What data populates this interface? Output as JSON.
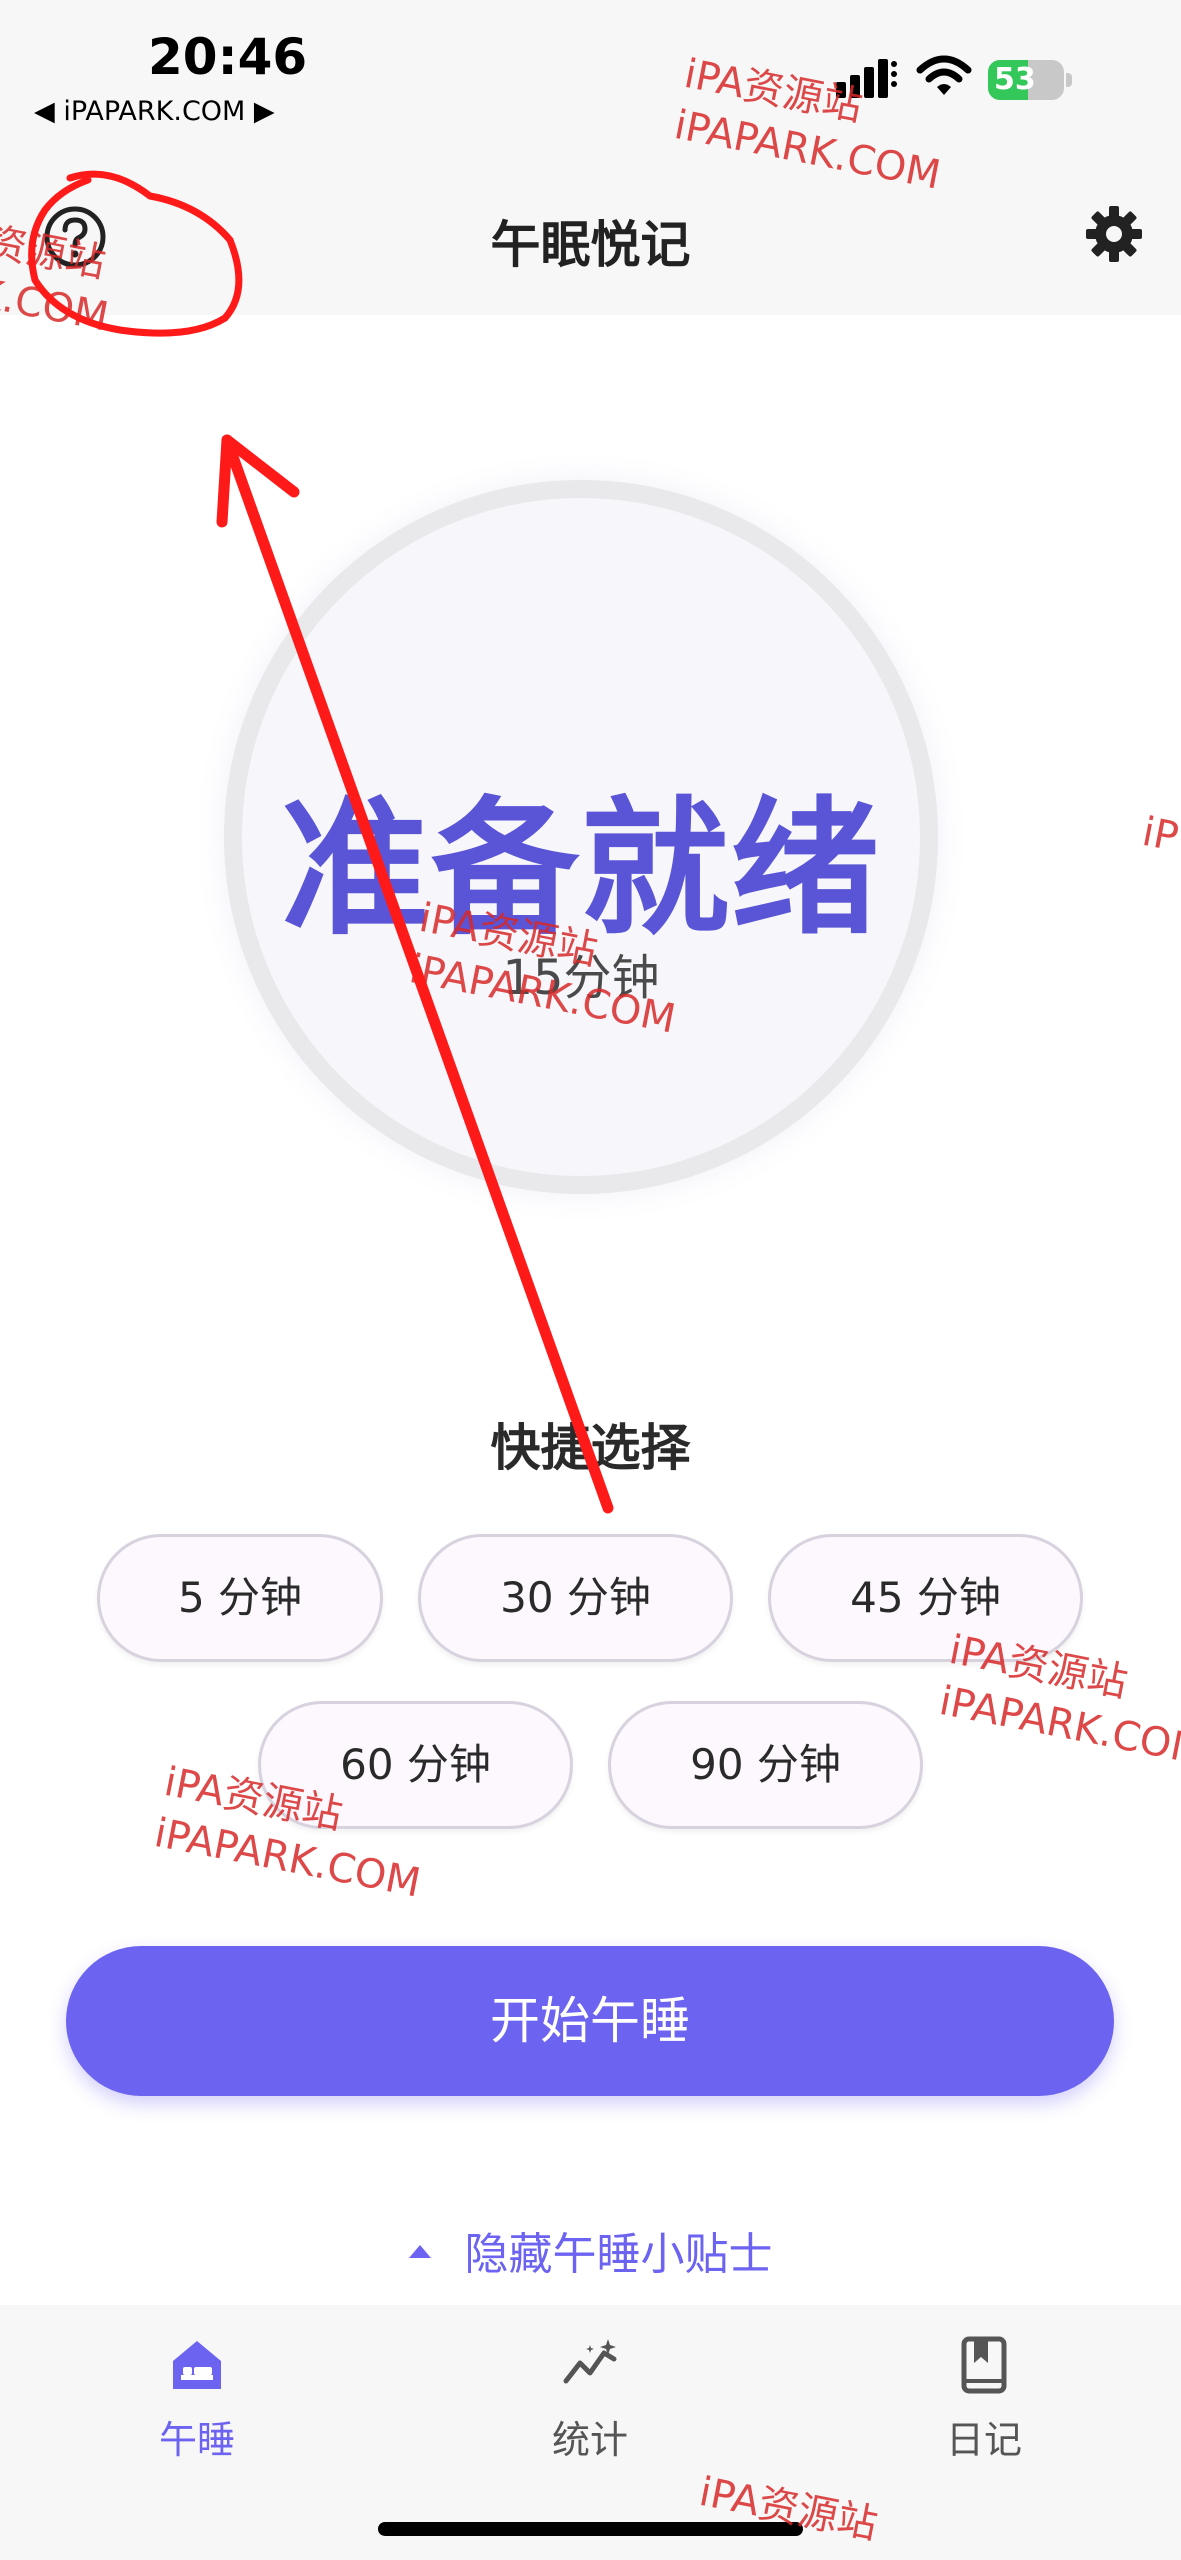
{
  "status_bar": {
    "time": "20:46",
    "back_link": "◀ iPAPARK.COM ▶",
    "battery_level": "53",
    "battery_fraction": 0.53
  },
  "header": {
    "title": "午眠悦记",
    "help_icon": "question-circle-icon",
    "settings_icon": "gear-icon"
  },
  "timer": {
    "status": "准备就绪",
    "duration": "15分钟"
  },
  "quick_select": {
    "title": "快捷选择",
    "options": [
      "5 分钟",
      "30 分钟",
      "45 分钟",
      "60 分钟",
      "90 分钟"
    ]
  },
  "start_button": {
    "label": "开始午睡"
  },
  "tips": {
    "toggle_label": "隐藏午睡小贴士"
  },
  "bottom_nav": {
    "items": [
      {
        "label": "午睡",
        "icon": "bed-icon",
        "active": true
      },
      {
        "label": "统计",
        "icon": "trend-chart-icon",
        "active": false
      },
      {
        "label": "日记",
        "icon": "bookmark-book-icon",
        "active": false
      }
    ]
  },
  "watermark": {
    "line1": "iPA资源站",
    "line2": "iPAPARK.COM",
    "fragment_site": "资源站",
    "fragment_com": "K.COM",
    "fragment_edge": "iP"
  },
  "colors": {
    "accent": "#6c63f0",
    "status_text": "#5a55d6",
    "annotation_red": "#ff1a1a",
    "battery_green": "#34c759"
  }
}
